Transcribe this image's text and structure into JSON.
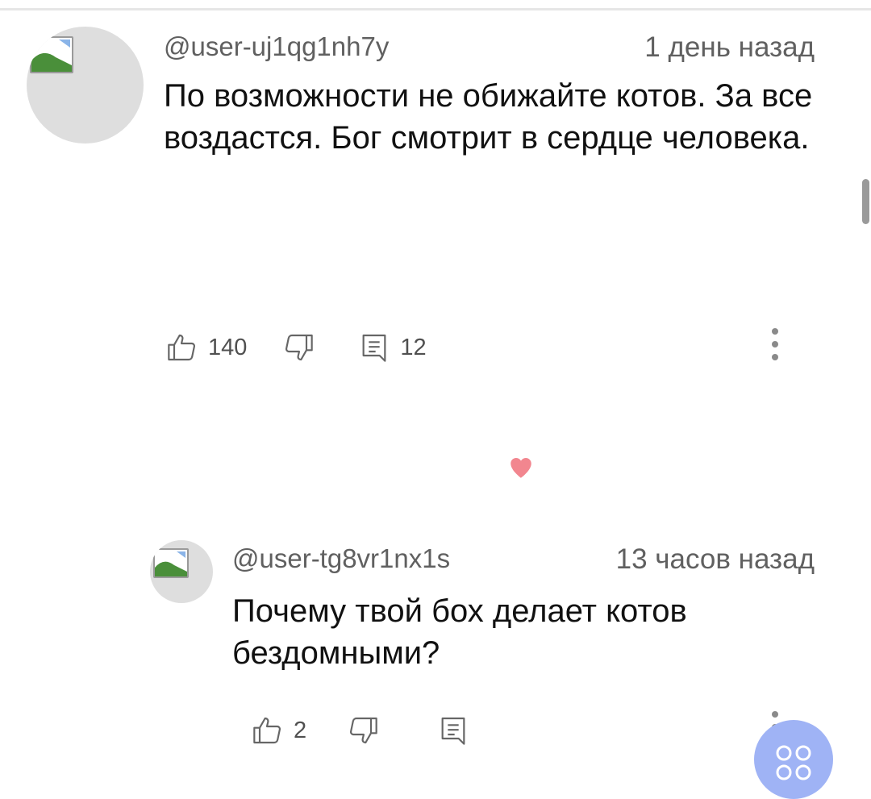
{
  "comment": {
    "username": "@user-uj1qg1nh7y",
    "time": "1 день назад",
    "text": "По возможности не обижайте котов. За все воздастся. Бог смотрит в сердце человека.",
    "like_count": "140",
    "reply_count": "12"
  },
  "reply": {
    "username": "@user-tg8vr1nx1s",
    "time": "13 часов назад",
    "text": "Почему твой бох делает котов бездомными?",
    "like_count": "2"
  },
  "colors": {
    "heart": "#f2868f",
    "fab": "#9fb3f5",
    "meta_text": "#606060"
  },
  "icons": [
    "thumbs-up-icon",
    "thumbs-down-icon",
    "reply-icon",
    "more-vertical-icon",
    "heart-icon",
    "broken-image-icon"
  ]
}
